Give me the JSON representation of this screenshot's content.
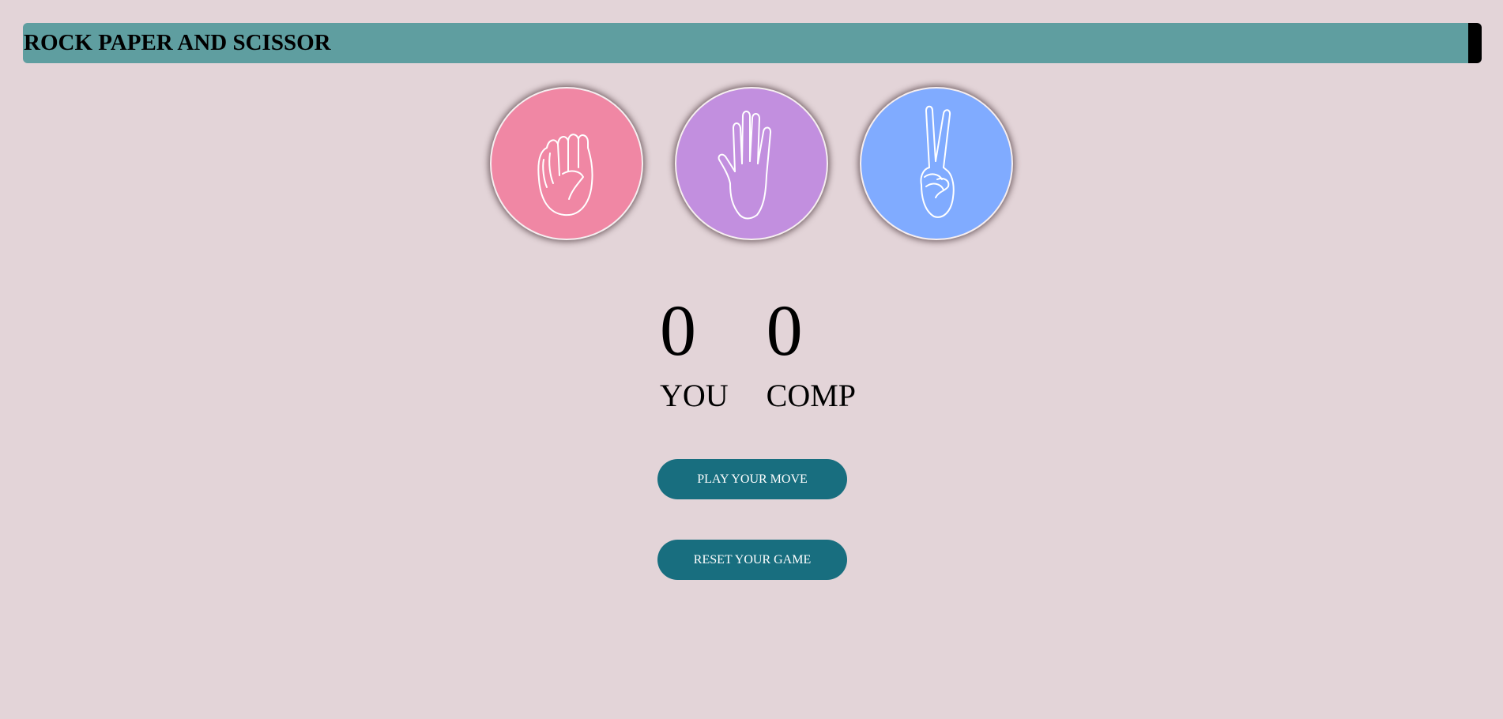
{
  "header": {
    "title": "ROCK PAPER AND SCISSOR"
  },
  "choices": [
    {
      "name": "rock",
      "icon": "rock-fist-icon",
      "color": "#f087a4"
    },
    {
      "name": "paper",
      "icon": "paper-hand-icon",
      "color": "#c28fdf"
    },
    {
      "name": "scissors",
      "icon": "scissors-hand-icon",
      "color": "#80abff"
    }
  ],
  "scoreboard": {
    "user": {
      "score": "0",
      "label": "YOU"
    },
    "comp": {
      "score": "0",
      "label": "COMP"
    }
  },
  "buttons": {
    "play": "PLAY YOUR MOVE",
    "reset": "RESET YOUR GAME"
  },
  "colors": {
    "background": "#e3d4d8",
    "header": "#5f9ea0",
    "button": "#186e7f"
  }
}
